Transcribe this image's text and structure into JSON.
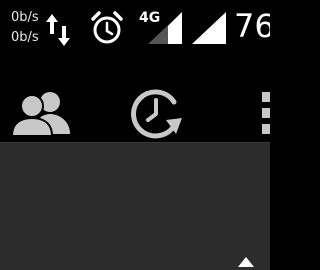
{
  "status_bar": {
    "upload_speed": "0b/s",
    "download_speed": "0b/s",
    "network_type": "4G",
    "battery_level_text": "76",
    "icons": [
      "data-transfer-icon",
      "alarm-icon",
      "signal-4g-icon",
      "signal-strength-icon"
    ]
  },
  "tabs": [
    {
      "name": "contacts",
      "icon": "contacts-icon"
    },
    {
      "name": "recents",
      "icon": "recents-icon"
    },
    {
      "name": "more",
      "icon": "more-icon"
    }
  ],
  "colors": {
    "status_background": "#000000",
    "content_background": "#2c2c2c",
    "icon_gray": "#c8c8c8",
    "text_white": "#ffffff"
  }
}
